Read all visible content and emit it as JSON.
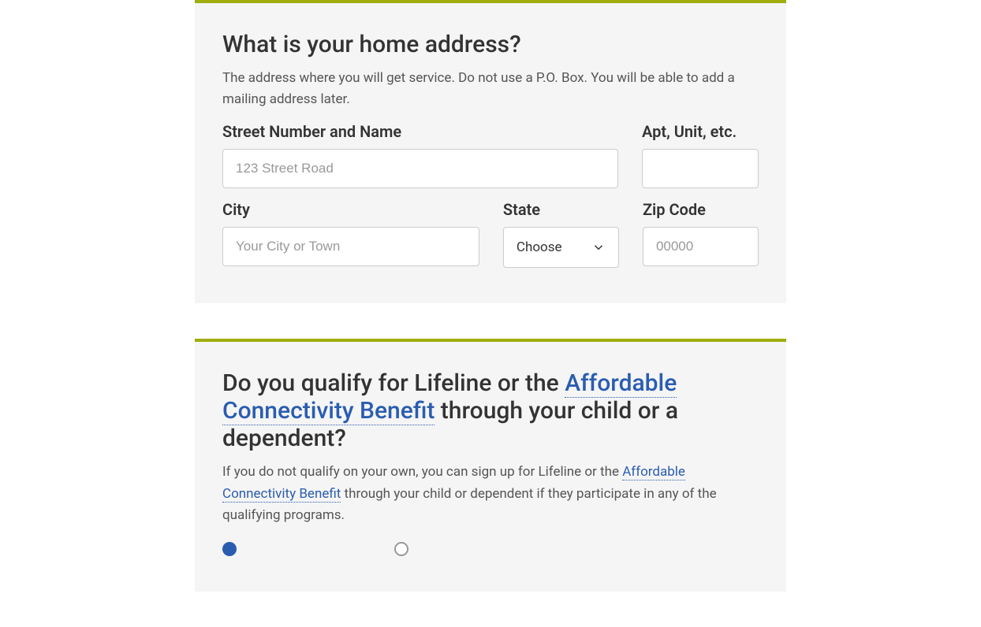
{
  "address": {
    "title": "What is your home address?",
    "subtitle": "The address where you will get service. Do not use a P.O. Box. You will be able to add a mailing address later.",
    "street_label": "Street Number and Name",
    "street_placeholder": "123 Street Road",
    "apt_label": "Apt, Unit, etc.",
    "city_label": "City",
    "city_placeholder": "Your City or Town",
    "state_label": "State",
    "state_selected": "Choose",
    "zip_label": "Zip Code",
    "zip_placeholder": "00000"
  },
  "qualify": {
    "title_part1": "Do you qualify for Lifeline or the ",
    "title_link": "Affordable Connectivity Benefit",
    "title_part2": " through your child or a dependent?",
    "subtitle_part1": "If you do not qualify on your own, you can sign up for Lifeline or the ",
    "subtitle_link": "Affordable Connectivity Benefit",
    "subtitle_part2": " through your child or dependent if they participate in any of the qualifying programs."
  }
}
